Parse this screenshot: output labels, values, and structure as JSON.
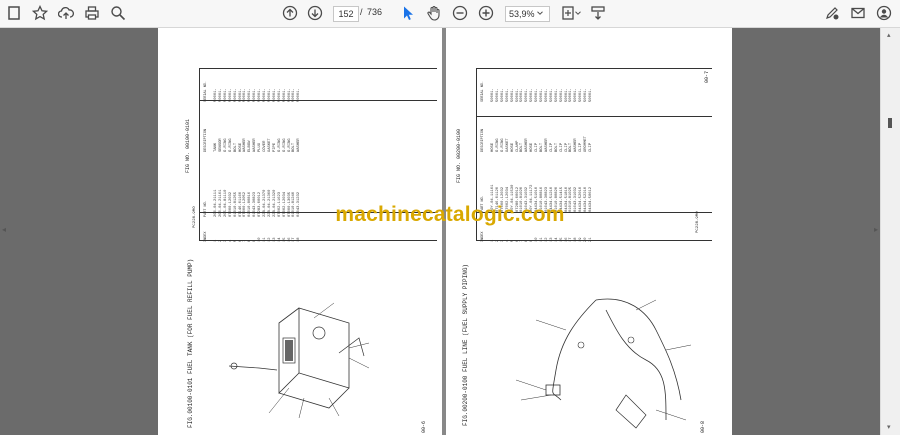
{
  "toolbar": {
    "icons": [
      "home-icon",
      "bookmark-star-icon",
      "upload-cloud-icon",
      "print-icon",
      "zoom-magnifier-icon",
      "page-up-icon",
      "page-down-icon",
      "select-cursor-icon",
      "hand-tool-icon",
      "zoom-out-icon",
      "zoom-in-icon",
      "fit-page-icon",
      "scroll-mode-icon",
      "sign-pen-icon",
      "mail-icon",
      "account-icon"
    ],
    "page_current": "152",
    "page_separator": "/",
    "page_total": "736",
    "zoom_value": "53,9%"
  },
  "watermark": "machinecatalogic.com",
  "left_page": {
    "fig_header": "FIG NO. 00100-0101",
    "fig_title": "FIG.00100-0101 FUEL TANK (FOR FUEL REFILL PUMP)",
    "footer_code": "00-6",
    "side_code": "PC228-9MO",
    "table_headers": [
      "INDEX",
      "PART NO.",
      "DESCRIPTION",
      "SERIAL NO."
    ],
    "table_rows": [
      [
        "1",
        "206-04-21111",
        "TANK",
        "50001-"
      ],
      [
        "2",
        "206-04-21161",
        "SENSOR",
        "50001-"
      ],
      [
        "3",
        "205-04-81110",
        "O-RING",
        "50001-"
      ],
      [
        "4",
        "07000-12032",
        "O-RING",
        "50001-"
      ],
      [
        "5",
        "01010-81255",
        "BOLT",
        "50001-"
      ],
      [
        "6",
        "07146-01160",
        "HOSE",
        "50001-"
      ],
      [
        "7",
        "07000-12052",
        "WASHER",
        "50001-"
      ],
      [
        "8",
        "01010-80816",
        "ELBOW",
        "50001-"
      ],
      [
        "9",
        "01643-30823",
        "WASHER",
        "50001-"
      ],
      [
        "10",
        "07283-00012",
        "PLUG",
        "50001-"
      ],
      [
        "11",
        "22B-04-21370",
        "COVER",
        "50001-"
      ],
      [
        "12",
        "22B-04-21360",
        "GASKET",
        "50001-"
      ],
      [
        "13",
        "22B-04-21320",
        "PIPE",
        "50001-"
      ],
      [
        "14",
        "07002-11623",
        "O-RING",
        "50001-"
      ],
      [
        "15",
        "07002-12034",
        "O-RING",
        "50001-"
      ],
      [
        "16",
        "07000-13035",
        "O-RING",
        "50001-"
      ],
      [
        "17",
        "01010-81240",
        "BOLT",
        "50001-"
      ],
      [
        "18",
        "01643-31232",
        "WASHER",
        "50001-"
      ]
    ]
  },
  "right_page": {
    "fig_header": "FIG NO. 00200-0100",
    "fig_title": "FIG.00200-0100 FUEL LINE (FUEL SUPPLY PIPING)",
    "footer_code": "00-8",
    "top_code": "00-7",
    "side_code": "PC228-9MO",
    "table_headers": [
      "INDEX",
      "PART NO.",
      "DESCRIPTION",
      "SERIAL NO."
    ],
    "table_rows": [
      [
        "1",
        "20Y-04-11161",
        "HOSE",
        "50001-"
      ],
      [
        "2",
        "07146-01120",
        "O-RING",
        "50001-"
      ],
      [
        "3",
        "07000-12032",
        "O-RING",
        "50001-"
      ],
      [
        "4",
        "07002-12034",
        "GASKET",
        "50001-"
      ],
      [
        "5",
        "20Y-04-11530",
        "HOSE",
        "50001-"
      ],
      [
        "6",
        "07280-00012",
        "CLAMP",
        "50001-"
      ],
      [
        "7",
        "01010-81020",
        "BOLT",
        "50001-"
      ],
      [
        "8",
        "01643-31032",
        "WASHER",
        "50001-"
      ],
      [
        "9",
        "20Y-04-11172",
        "HOSE",
        "50001-"
      ],
      [
        "10",
        "04434-51010",
        "CLIP",
        "50001-"
      ],
      [
        "11",
        "01010-80816",
        "BOLT",
        "50001-"
      ],
      [
        "12",
        "01643-30823",
        "WASHER",
        "50001-"
      ],
      [
        "13",
        "04434-51210",
        "CLIP",
        "50001-"
      ],
      [
        "14",
        "01010-80820",
        "BOLT",
        "50001-"
      ],
      [
        "15",
        "04434-51415",
        "CLIP",
        "50001-"
      ],
      [
        "16",
        "04434-51810",
        "CLIP",
        "50001-"
      ],
      [
        "17",
        "01010-81025",
        "BOLT",
        "50001-"
      ],
      [
        "18",
        "01643-31032",
        "WASHER",
        "50001-"
      ],
      [
        "19",
        "04434-52010",
        "CLIP",
        "50001-"
      ],
      [
        "20",
        "04434-52210",
        "GROMMET",
        "50001-"
      ],
      [
        "21",
        "04434-50612",
        "CLIP",
        "50001-"
      ]
    ]
  }
}
